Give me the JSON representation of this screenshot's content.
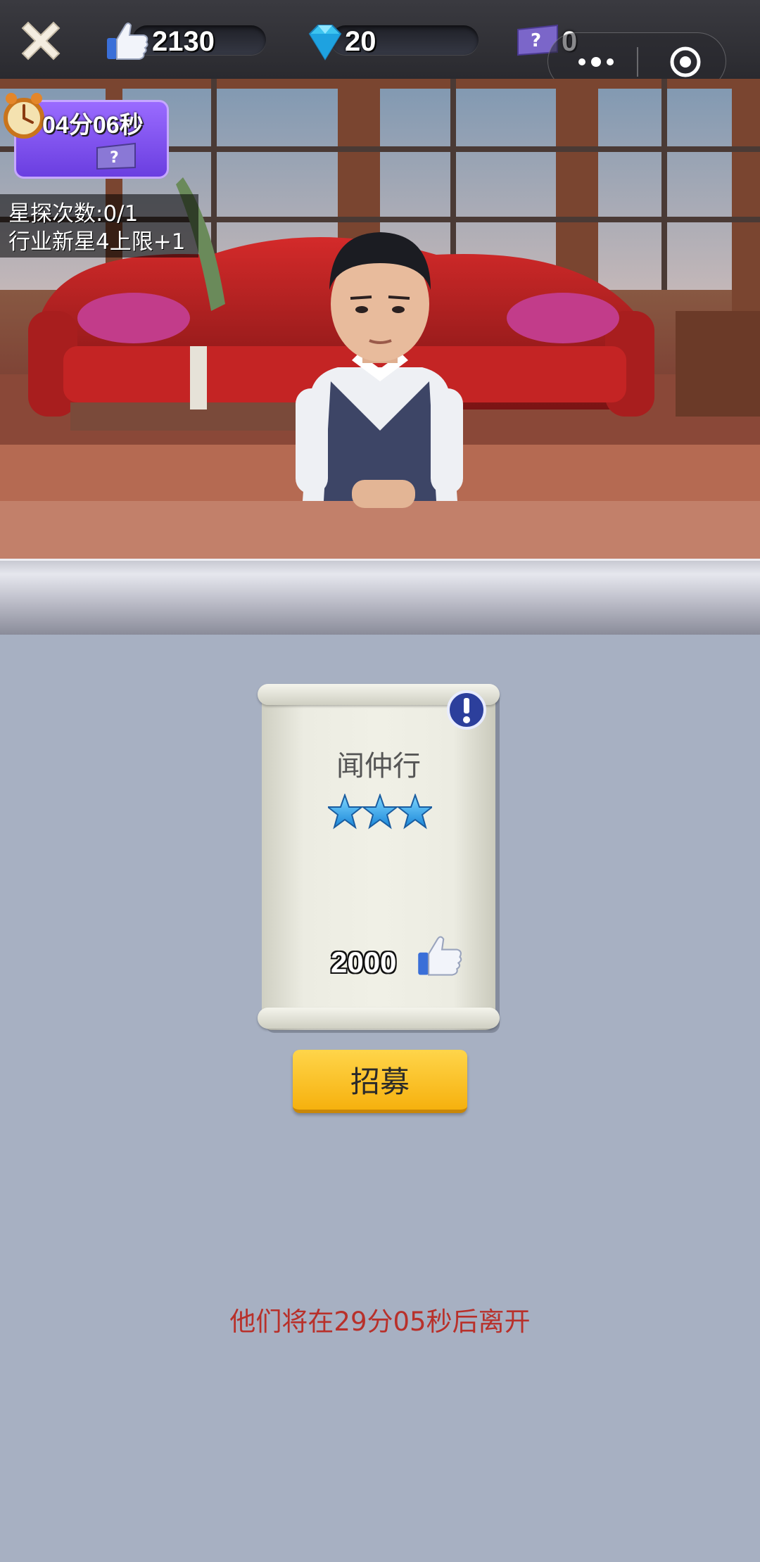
{
  "topbar": {
    "likes": "2130",
    "diamonds": "20",
    "tickets": "0"
  },
  "event": {
    "timer": "04分06秒",
    "scout_count": "星探次数:0/1",
    "rookie_bonus": "行业新星4上限+1"
  },
  "candidate": {
    "name": "闻仲行",
    "stars": 3,
    "cost": "2000"
  },
  "actions": {
    "recruit_label": "招募"
  },
  "footer": {
    "leave_notice": "他们将在29分05秒后离开"
  },
  "colors": {
    "accent_yellow": "#f6b10e",
    "timer_purple": "#7b4cf0",
    "notice_red": "#b8302a"
  }
}
